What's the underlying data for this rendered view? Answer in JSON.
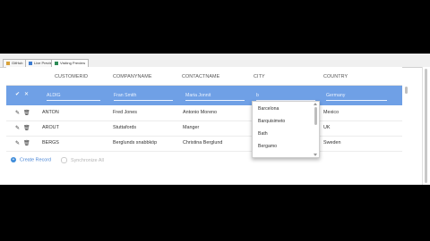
{
  "window": {
    "tabs": [
      {
        "label": "GitHub",
        "icon": "github-icon",
        "color": "#d8a23a"
      },
      {
        "label": "Live Preview",
        "icon": "preview-icon",
        "color": "#3c7bd0"
      },
      {
        "label": "Visiting Preview",
        "icon": "window-icon",
        "color": "#2e8b57"
      }
    ]
  },
  "grid": {
    "columns": [
      "CustomerID",
      "CompanyName",
      "ContactName",
      "City",
      "Country"
    ],
    "edit_row": {
      "customer_id": "ALDIG",
      "company_name": "Fran Smith",
      "contact_name": "Maria Jonnit",
      "city": "b",
      "country": "Germany"
    },
    "rows": [
      {
        "customer_id": "ANTON",
        "company_name": "Fred Jones",
        "contact_name": "Antonio Moreno",
        "city": "",
        "country": "Mexico"
      },
      {
        "customer_id": "AROUT",
        "company_name": "Stuttafords",
        "contact_name": "Manger",
        "city": "",
        "country": "UK"
      },
      {
        "customer_id": "BERGS",
        "company_name": "Berglunds snabbköp",
        "contact_name": "Christina Berglund",
        "city": "",
        "country": "Sweden"
      }
    ],
    "city_options": [
      "Barcelona",
      "Barquisimeto",
      "Bath",
      "Bergamo"
    ]
  },
  "footer": {
    "create_label": "Create Record",
    "sync_label": "Synchronize All"
  },
  "colors": {
    "edit_row_bg": "#6fa0e6",
    "accent": "#3d8bd9"
  }
}
